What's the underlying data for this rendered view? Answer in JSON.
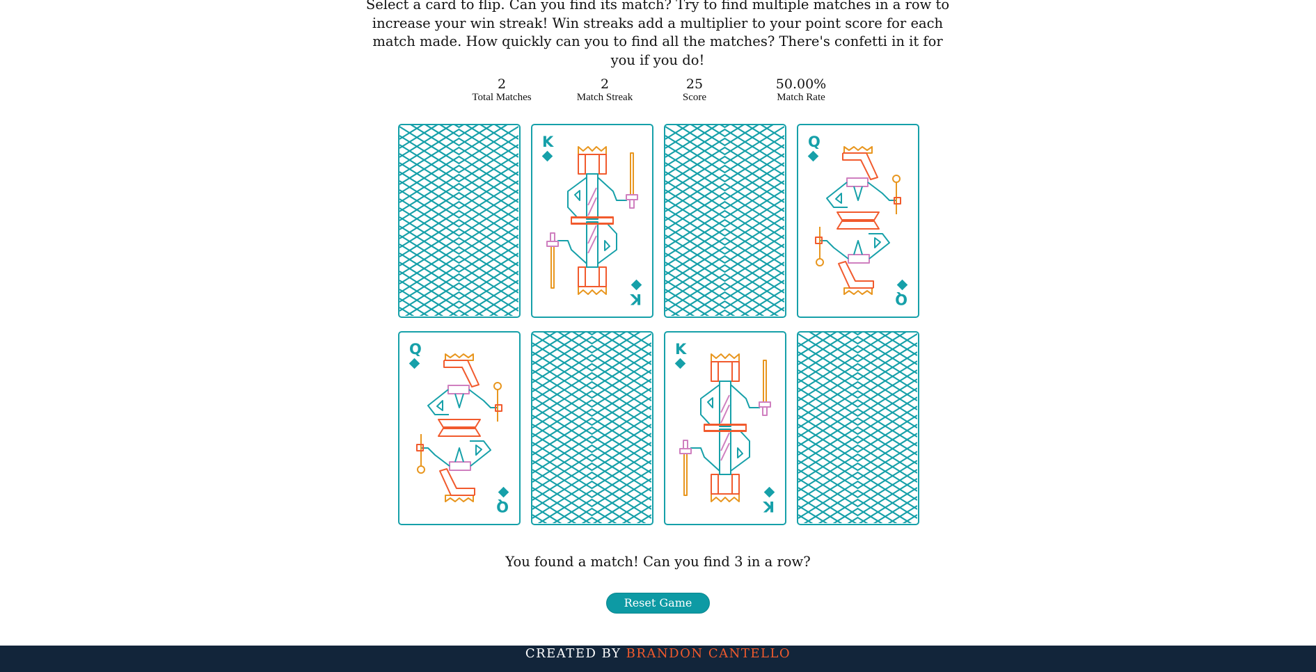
{
  "intro": "Select a card to flip. Can you find its match? Try to find multiple matches in a row to increase your win streak! Win streaks add a multiplier to your point score for each match made. How quickly can you to find all the matches? There's confetti in it for you if you do!",
  "stats": [
    {
      "value": "2",
      "label": "Total Matches"
    },
    {
      "value": "2",
      "label": "Match Streak"
    },
    {
      "value": "25",
      "label": "Score"
    },
    {
      "value": "50.00%",
      "label": "Match Rate"
    }
  ],
  "cards": [
    {
      "state": "back"
    },
    {
      "state": "face",
      "rank": "K",
      "suit": "diamond"
    },
    {
      "state": "back"
    },
    {
      "state": "face",
      "rank": "Q",
      "suit": "diamond"
    },
    {
      "state": "face",
      "rank": "Q",
      "suit": "diamond"
    },
    {
      "state": "back"
    },
    {
      "state": "face",
      "rank": "K",
      "suit": "diamond"
    },
    {
      "state": "back"
    }
  ],
  "message": "You found a match! Can you find 3 in a row?",
  "reset_label": "Reset Game",
  "footer": {
    "prefix": "CREATED BY",
    "author": "BRANDON CANTELLO"
  },
  "colors": {
    "teal": "#16a0a9",
    "orange": "#f15a2d",
    "gold": "#e8961e",
    "pink": "#cf7fbf",
    "navy": "#12253a"
  }
}
